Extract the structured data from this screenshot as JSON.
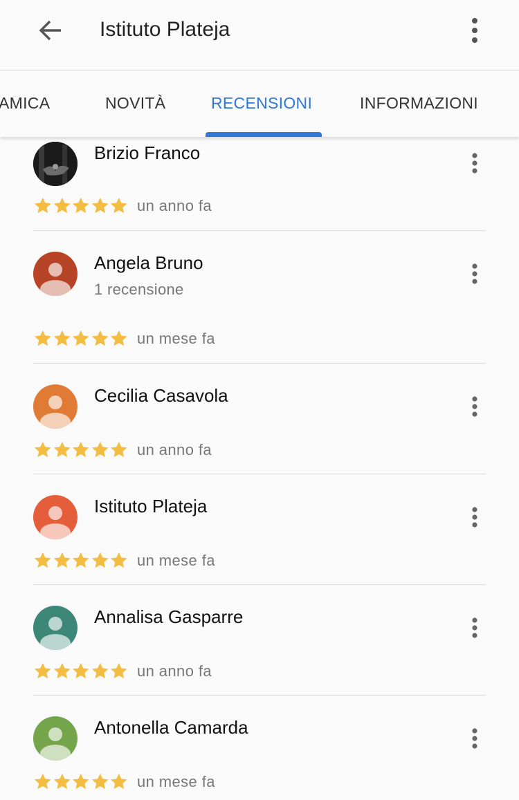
{
  "appbar": {
    "title": "Istituto Plateja",
    "back_icon": "arrow-back-icon",
    "menu_icon": "more-vert-icon"
  },
  "tabs": [
    {
      "label": "AMICA",
      "active": false
    },
    {
      "label": "NOVITÀ",
      "active": false
    },
    {
      "label": "RECENSIONI",
      "active": true
    },
    {
      "label": "INFORMAZIONI",
      "active": false
    }
  ],
  "colors": {
    "accent": "#2f78d8",
    "star": "#f2bd42",
    "text_secondary": "#777777"
  },
  "reviews": [
    {
      "name": "Brizio Franco",
      "subtitle": "",
      "rating": 5,
      "date": "un anno fa",
      "avatar": "photo",
      "avatar_color": "#1c1c1c"
    },
    {
      "name": "Angela Bruno",
      "subtitle": "1 recensione",
      "rating": 5,
      "date": "un mese fa",
      "avatar": "person-icon",
      "avatar_color": "#b84427"
    },
    {
      "name": "Cecilia Casavola",
      "subtitle": "",
      "rating": 5,
      "date": "un anno fa",
      "avatar": "person-icon",
      "avatar_color": "#e07b35"
    },
    {
      "name": "Istituto Plateja",
      "subtitle": "",
      "rating": 5,
      "date": "un mese fa",
      "avatar": "person-icon",
      "avatar_color": "#e45e3b"
    },
    {
      "name": "Annalisa Gasparre",
      "subtitle": "",
      "rating": 5,
      "date": "un anno fa",
      "avatar": "person-icon",
      "avatar_color": "#3d8779"
    },
    {
      "name": "Antonella Camarda",
      "subtitle": "",
      "rating": 5,
      "date": "un mese fa",
      "avatar": "person-icon",
      "avatar_color": "#75a54b"
    }
  ]
}
